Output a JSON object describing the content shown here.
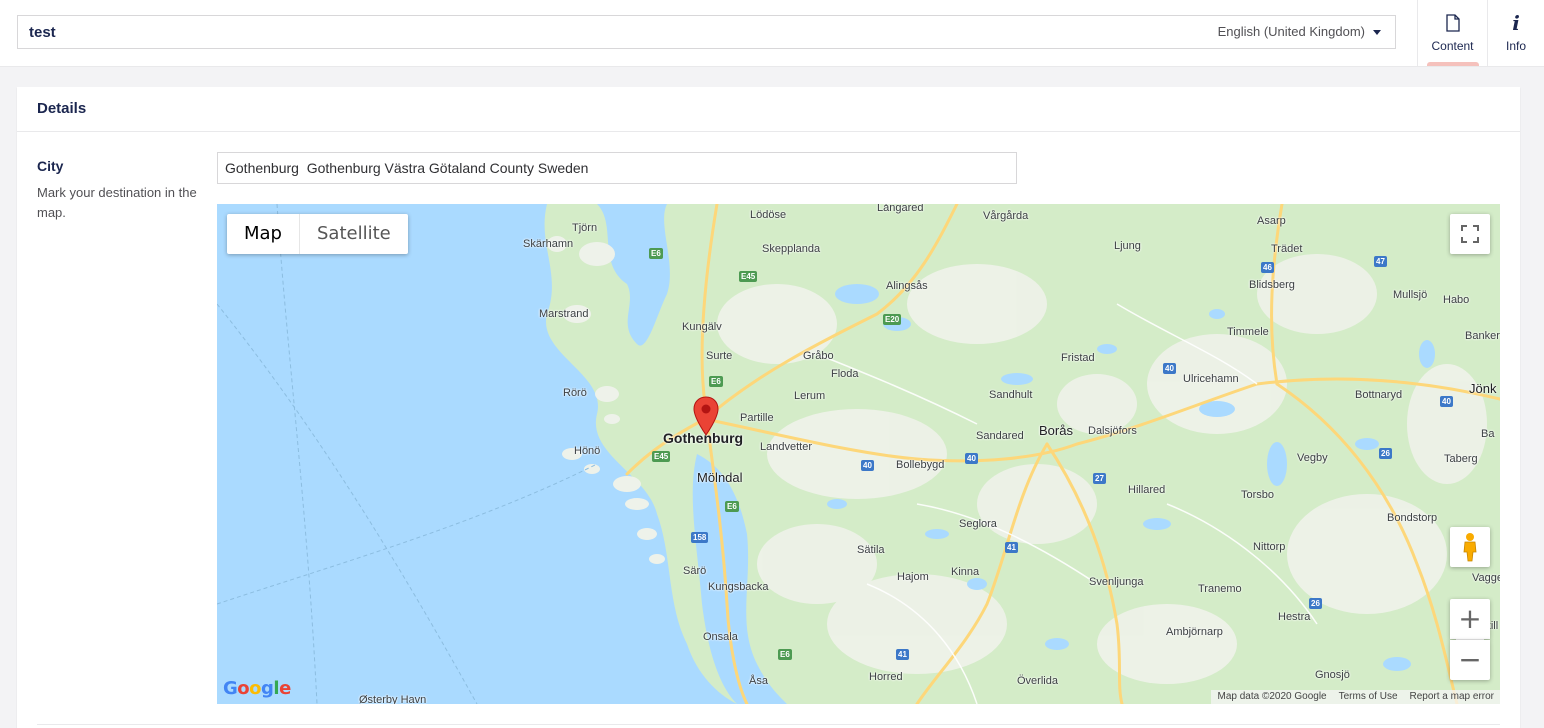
{
  "header": {
    "node_name": "test",
    "language": "English (United Kingdom)",
    "tabs": [
      {
        "label": "Content",
        "icon": "document-icon",
        "active": true
      },
      {
        "label": "Info",
        "icon": "info-icon",
        "active": false
      }
    ]
  },
  "panel": {
    "title": "Details",
    "property": {
      "label": "City",
      "description": "Mark your destination in the map.",
      "value": "Gothenburg  Gothenburg Västra Götaland County Sweden"
    }
  },
  "map": {
    "type_buttons": {
      "map": "Map",
      "satellite": "Satellite"
    },
    "selected_type": "Map",
    "marker_place": "Gothenburg",
    "attribution": {
      "data": "Map data ©2020 Google",
      "terms": "Terms of Use",
      "report": "Report a map error"
    },
    "places": {
      "gothenburg": "Gothenburg",
      "molndal": "Mölndal",
      "boras": "Borås",
      "tjorn": "Tjörn",
      "skarhamn": "Skärhamn",
      "lodose": "Lödöse",
      "skepplanda": "Skepplanda",
      "langared": "Långared",
      "vargarda": "Vårgårda",
      "asarp": "Asarp",
      "tradet": "Trädet",
      "ljung": "Ljung",
      "alingsas": "Alingsås",
      "blidsberg": "Blidsberg",
      "mullsjo": "Mullsjö",
      "habo": "Habo",
      "marstrand": "Marstrand",
      "kungalv": "Kungälv",
      "timmele": "Timmele",
      "bankeryd": "Banker",
      "surte": "Surte",
      "grabo": "Gråbo",
      "fristad": "Fristad",
      "floda": "Floda",
      "ulricehamn": "Ulricehamn",
      "jonkoping": "Jönk",
      "rorö": "Rörö",
      "lerum": "Lerum",
      "sandhult": "Sandhult",
      "bottnaryd": "Bottnaryd",
      "partille": "Partille",
      "sandared": "Sandared",
      "dalsjofors": "Dalsjöfors",
      "hono": "Hönö",
      "landvetter": "Landvetter",
      "bollebygd": "Bollebygd",
      "vegby": "Vegby",
      "taberg": "Taberg",
      "hillared": "Hillared",
      "torsbo": "Torsbo",
      "bondstorp": "Bondstorp",
      "seglora": "Seglora",
      "satila": "Sätila",
      "nittorp": "Nittorp",
      "vaggeryd": "Vagge",
      "hajom": "Hajom",
      "kinna": "Kinna",
      "svenljunga": "Svenljunga",
      "saro": "Särö",
      "kungsbacka": "Kungsbacka",
      "tranemo": "Tranemo",
      "hestra": "Hestra",
      "onsala": "Onsala",
      "ambjornarp": "Ambjörnarp",
      "asa": "Åsa",
      "horred": "Horred",
      "overlida": "Överlida",
      "gnosjo": "Gnosjö",
      "osterby": "Østerby Havn",
      "ba": "Ba",
      "skill": "Skill"
    },
    "road_shields": {
      "e6": "E6",
      "e45": "E45",
      "e20": "E20",
      "r40": "40",
      "r46": "46",
      "r47": "47",
      "r27": "27",
      "r26": "26",
      "r41": "41",
      "r158": "158"
    },
    "colors": {
      "water": "#aadaff",
      "land": "#d4ecc8",
      "road": "#fdd77a",
      "marker": "#ea4335"
    }
  }
}
